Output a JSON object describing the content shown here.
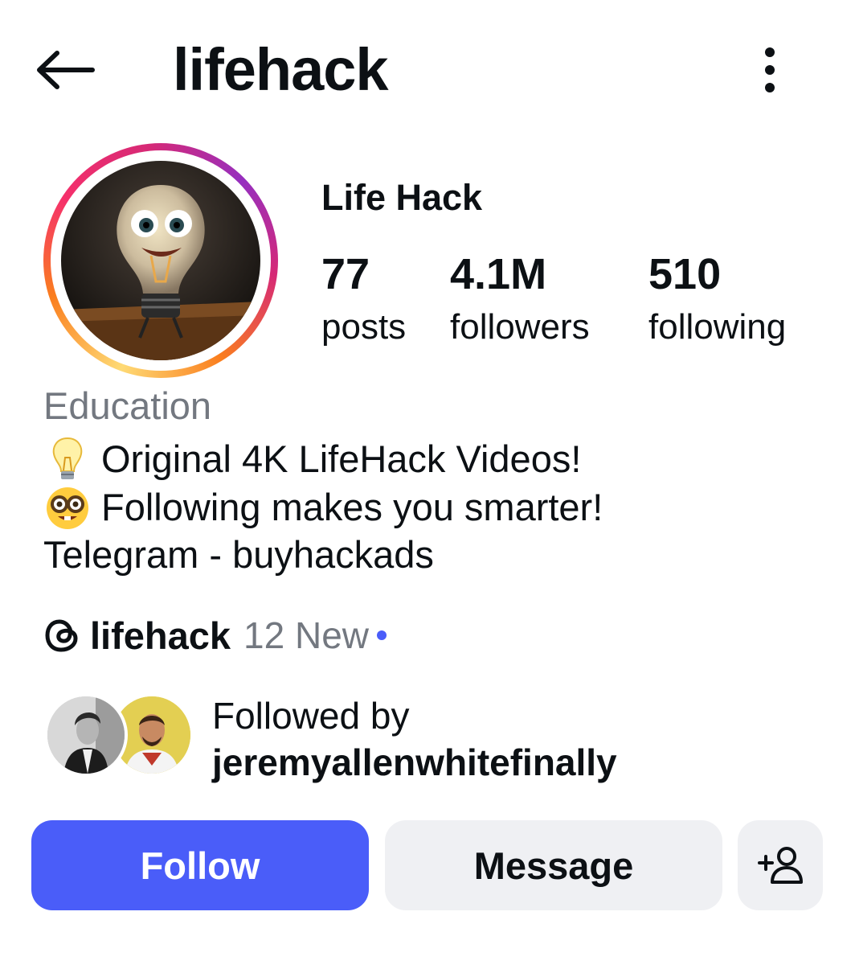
{
  "header": {
    "username": "lifehack",
    "back_icon": "arrow-left-icon",
    "menu_icon": "more-vertical-icon"
  },
  "profile": {
    "display_name": "Life Hack",
    "stats": [
      {
        "value": "77",
        "label": "posts"
      },
      {
        "value": "4.1M",
        "label": "followers"
      },
      {
        "value": "510",
        "label": "following"
      }
    ],
    "category": "Education",
    "bio": [
      {
        "icon": "lightbulb-emoji",
        "text": "Original 4K LifeHack Videos!"
      },
      {
        "icon": "nerd-face-emoji",
        "text": "Following makes you smarter!"
      },
      {
        "icon": "",
        "text": "Telegram - buyhackads"
      }
    ]
  },
  "threads": {
    "icon": "threads-icon",
    "handle": "lifehack",
    "count_text": "12 New",
    "dot_color": "#4a5df9"
  },
  "followed_by": {
    "label": "Followed by",
    "user": "jeremyallenwhitefinally"
  },
  "actions": {
    "follow_label": "Follow",
    "message_label": "Message",
    "add_icon": "add-person-icon"
  },
  "colors": {
    "accent": "#4a5df9",
    "muted": "#737880",
    "button_bg": "#eff0f3"
  }
}
